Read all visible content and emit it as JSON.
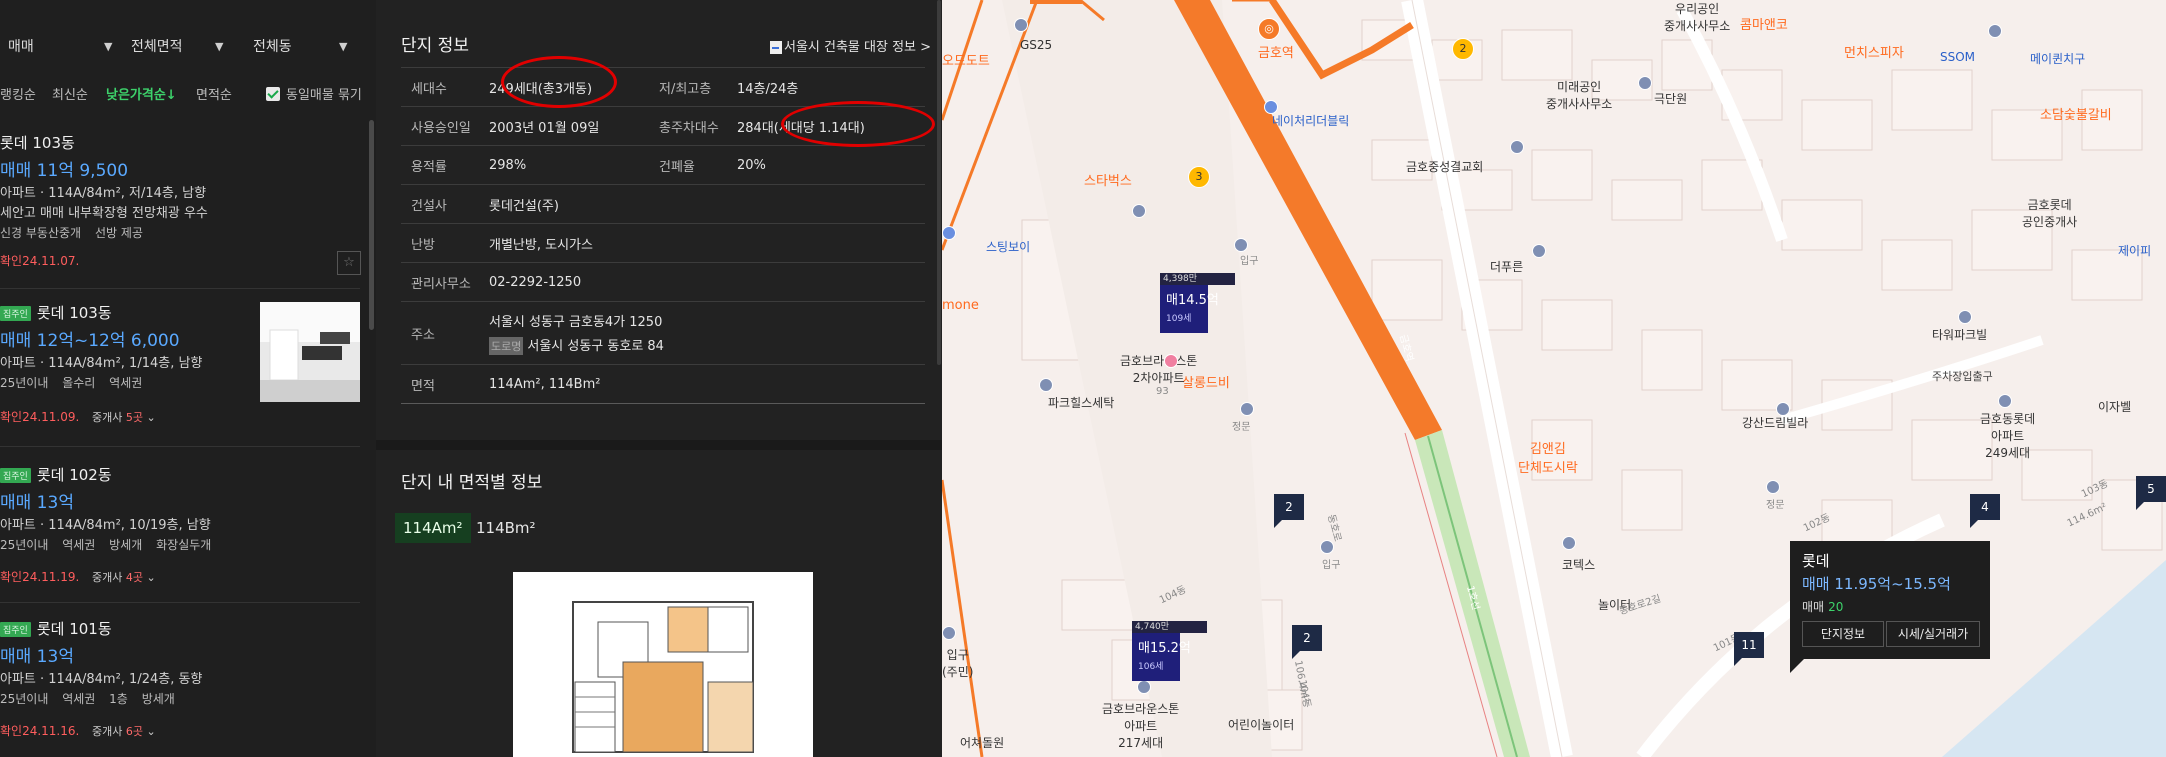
{
  "filters": {
    "trade": "매매",
    "area": "전체면적",
    "dong": "전체동"
  },
  "sort": {
    "options": [
      "랭킹순",
      "최신순",
      "낮은가격순↓",
      "면적순"
    ],
    "same_listing_label": "동일매물 묶기"
  },
  "listings": [
    {
      "name": "롯데 103동",
      "price": "매매 11억 9,500",
      "spec": "아파트 · 114A/84m², 저/14층, 남향",
      "desc": "세안고 매매 내부확장형 전망채광 우수",
      "tags": [
        "신경 부동산중개",
        "선방 제공"
      ],
      "confirmed": "확인24.11.07."
    },
    {
      "badge": "집주인",
      "name": "롯데 103동",
      "price": "매매 12억~12억 6,000",
      "spec": "아파트 · 114A/84m², 1/14층, 남향",
      "tags": [
        "25년이내",
        "올수리",
        "역세권"
      ],
      "confirmed": "확인24.11.09.",
      "broker_prefix": "중개사",
      "broker_count": "5곳"
    },
    {
      "badge": "집주인",
      "name": "롯데 102동",
      "price": "매매 13억",
      "spec": "아파트 · 114A/84m², 10/19층, 남향",
      "tags": [
        "25년이내",
        "역세권",
        "방세개",
        "화장실두개"
      ],
      "confirmed": "확인24.11.19.",
      "broker_prefix": "중개사",
      "broker_count": "4곳"
    },
    {
      "badge": "집주인",
      "name": "롯데 101동",
      "price": "매매 13억",
      "spec": "아파트 · 114A/84m², 1/24층, 동향",
      "tags": [
        "25년이내",
        "역세권",
        "1층",
        "방세개"
      ],
      "confirmed": "확인24.11.16.",
      "broker_prefix": "중개사",
      "broker_count": "6곳"
    }
  ],
  "complex": {
    "title": "단지 정보",
    "building_link": "서울시 건축물 대장 정보 >",
    "rows": {
      "households_label": "세대수",
      "households": "249세대(총3개동)",
      "floors_label": "저/최고층",
      "floors": "14층/24층",
      "approval_label": "사용승인일",
      "approval": "2003년 01월 09일",
      "parking_label": "총주차대수",
      "parking": "284대(세대당 1.14대)",
      "far_label": "용적률",
      "far": "298%",
      "bcr_label": "건폐율",
      "bcr": "20%",
      "builder_label": "건설사",
      "builder": "롯데건설(주)",
      "heating_label": "난방",
      "heating": "개별난방, 도시가스",
      "office_label": "관리사무소",
      "office": "02-2292-1250",
      "address_label": "주소",
      "address": "서울시 성동구 금호동4가 1250",
      "road_badge": "도로명",
      "road_address": "서울시 성동구 동호로 84",
      "area_label": "면적",
      "area": "114Am², 114Bm²"
    },
    "area_title": "단지 내 면적별 정보",
    "area_tabs": [
      "114Am²",
      "114Bm²"
    ]
  },
  "map": {
    "labels": {
      "geumho_station": "금호역",
      "gs25": "GS25",
      "odo": "오드도트",
      "starbucks": "스타벅스",
      "stingboy": "스팅보이",
      "mone": "mone",
      "geumho_church": "금호중성결교회",
      "naeil": "네이처리더블릭",
      "mirae": "미래공인\n중개사사무소",
      "gukdanwon": "극단원",
      "theprun": "더푸른",
      "woori": "우리공인\n중개사사무소",
      "combi": "콤마앤코",
      "munch": "먼치스피자",
      "ssom": "SSOM",
      "maple": "메이퀸치구",
      "sodang": "소담숯불갈비",
      "lotte_broker": "금호롯데\n공인중개사",
      "jeil": "제이피",
      "tower": "타워파크빌",
      "parking": "주차장입출구",
      "gangsan": "강산드림빌라",
      "lotte_apt": "금호동롯데\n아파트\n249세대",
      "izbel": "이자벨",
      "kim": "김앤김\n단체도시락",
      "jeongmun": "정문",
      "salon": "살롱드비",
      "park": "파크힐스세탁",
      "brown2": "금호브라운스톤\n2차아파트",
      "brown2_num": "93",
      "ipgu": "입구",
      "kotex": "코텍스",
      "playground": "놀이터",
      "brown": "금호브라운스톤\n아파트\n217세대",
      "daycare": "어린이놀이터",
      "eocheo": "어쳐돌원",
      "ipgu2": "입구\n(주민)",
      "dongho": "동호로",
      "ipgu3": "입구",
      "jeongmun2": "정문",
      "road_label": "동호로2길",
      "lane_102": "102동",
      "lane_101": "101동",
      "lane_103": "103동",
      "lane_104": "104동",
      "lane_104s": "104동",
      "area_114": "114.6m²",
      "area_106": "106.4m²",
      "green_label": "1호선",
      "rail_label": "금호역"
    },
    "subway_numbers": [
      "2",
      "3"
    ],
    "pins": [
      {
        "top": "4,398만",
        "price": "매14.5억",
        "hh": "109세"
      },
      {
        "top": "4,740만",
        "price": "매15.2억",
        "hh": "106세"
      }
    ],
    "counts": [
      "2",
      "2",
      "4",
      "11",
      "5"
    ],
    "popup": {
      "name": "롯데",
      "price": "매매 11.95억~15.5억",
      "count_label": "매매",
      "count": "20",
      "btn_info": "단지정보",
      "btn_price": "시세/실거래가"
    },
    "colors": {
      "line3": "#f57a28",
      "green": "#7cc47a",
      "bg": "#f6efec"
    }
  }
}
